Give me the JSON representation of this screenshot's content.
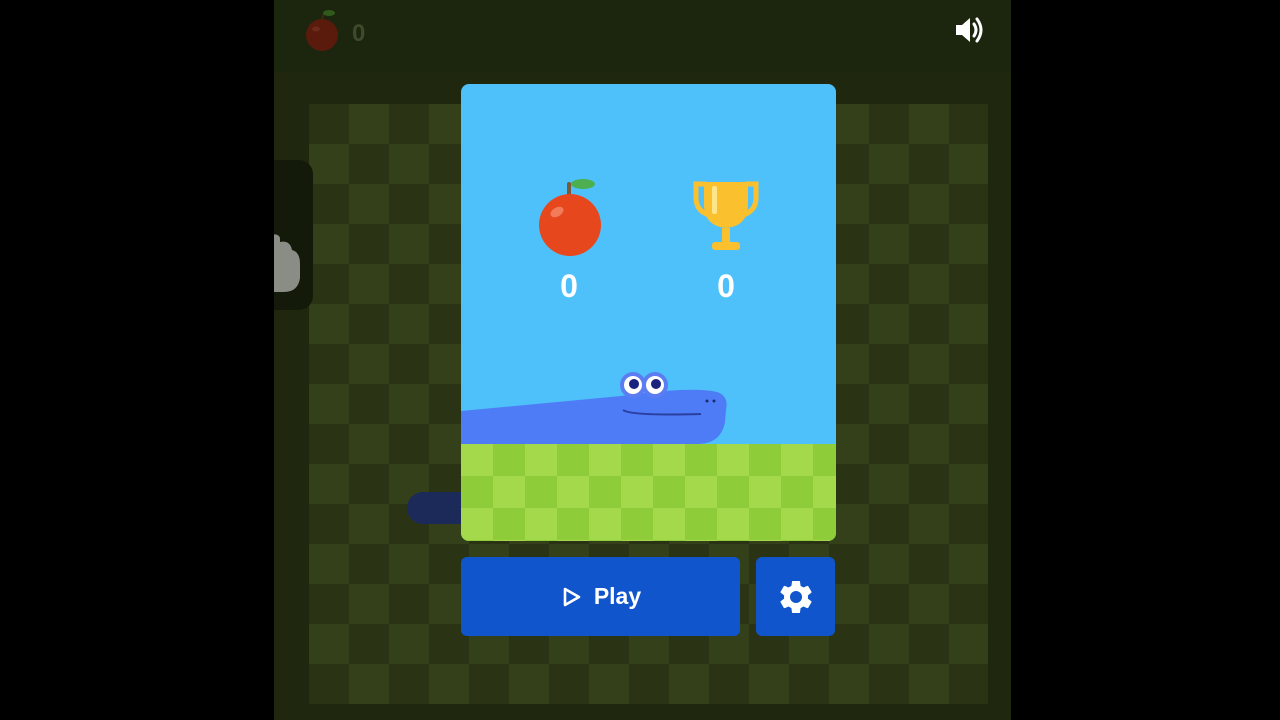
{
  "header": {
    "score": "0",
    "apple_icon": "apple-icon",
    "sound_icon": "volume-icon"
  },
  "menu_card": {
    "apple_score": "0",
    "best_score": "0",
    "apple_icon": "apple-icon",
    "trophy_icon": "trophy-icon"
  },
  "buttons": {
    "play_label": "Play",
    "play_icon": "play-triangle-icon",
    "settings_icon": "gear-icon"
  },
  "colors": {
    "sky": "#4fc1fa",
    "grass_light": "#a4d94b",
    "grass_dark": "#8ecc39",
    "button": "#1155cc",
    "snake": "#4e7cf6",
    "apple": "#e7471d",
    "trophy": "#fbc02d"
  }
}
